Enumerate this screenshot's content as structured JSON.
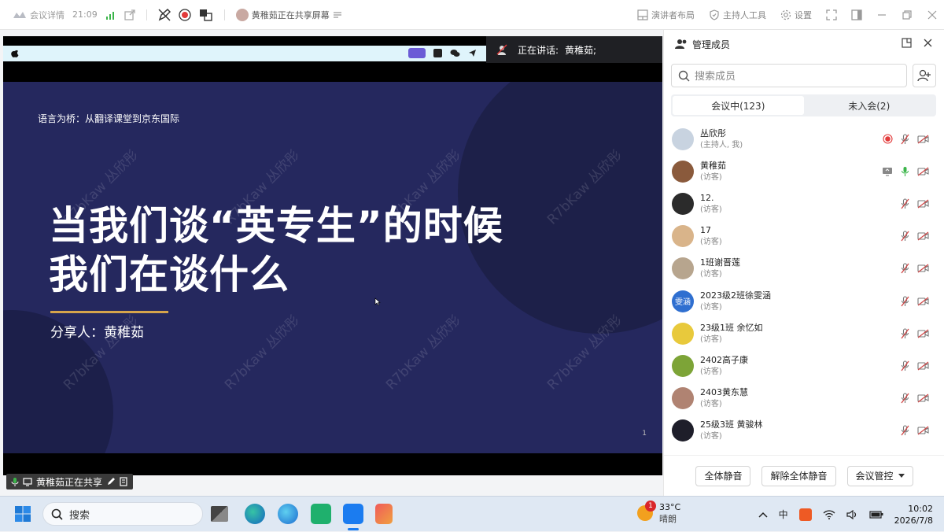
{
  "topbar": {
    "meeting_details": "会议详情",
    "time": "21:09",
    "sharing_label": "黄稚茹正在共享屏幕",
    "presenter_layout": "演讲者布局",
    "host_tools": "主持人工具",
    "settings": "设置"
  },
  "stage": {
    "speaking_prefix": "正在讲话:",
    "speaking_name": "黄稚茹;",
    "sharing_badge": "黄稚茹正在共享"
  },
  "slide": {
    "subtitle": "语言为桥：从翻译课堂到京东国际",
    "title_line1": "当我们谈“英专生”的时候",
    "title_line2": "我们在谈什么",
    "presenter": "分享人：黄稚茹",
    "page": "1",
    "watermark": "R7bKaw 丛欣彤"
  },
  "panel": {
    "title": "管理成员",
    "search_placeholder": "搜索成员",
    "tab_in_meeting": "会议中(123)",
    "tab_not_joined": "未入会(2)",
    "members": [
      {
        "name": "丛欣彤",
        "role": "(主持人, 我)",
        "avatar_color": "#c8d3e0",
        "avatar_text": "",
        "recording": true,
        "sharing": false,
        "mic": "muted"
      },
      {
        "name": "黄稚茹",
        "role": "(访客)",
        "avatar_color": "#8a5a3c",
        "avatar_text": "",
        "recording": false,
        "sharing": true,
        "mic": "on"
      },
      {
        "name": "12.",
        "role": "(访客)",
        "avatar_color": "#2b2b2b",
        "avatar_text": "",
        "recording": false,
        "sharing": false,
        "mic": "muted"
      },
      {
        "name": "17",
        "role": "(访客)",
        "avatar_color": "#d9b48a",
        "avatar_text": "",
        "recording": false,
        "sharing": false,
        "mic": "muted"
      },
      {
        "name": "1班谢晋莲",
        "role": "(访客)",
        "avatar_color": "#b7a58e",
        "avatar_text": "",
        "recording": false,
        "sharing": false,
        "mic": "muted"
      },
      {
        "name": "2023级2班徐雯涵",
        "role": "(访客)",
        "avatar_color": "#2f6fd0",
        "avatar_text": "雯涵",
        "recording": false,
        "sharing": false,
        "mic": "muted"
      },
      {
        "name": "23级1班 余忆如",
        "role": "(访客)",
        "avatar_color": "#e8c93c",
        "avatar_text": "",
        "recording": false,
        "sharing": false,
        "mic": "muted"
      },
      {
        "name": "2402高子康",
        "role": "(访客)",
        "avatar_color": "#7da437",
        "avatar_text": "",
        "recording": false,
        "sharing": false,
        "mic": "muted"
      },
      {
        "name": "2403黄东慧",
        "role": "(访客)",
        "avatar_color": "#b08372",
        "avatar_text": "",
        "recording": false,
        "sharing": false,
        "mic": "muted"
      },
      {
        "name": "25级3班 黄骏林",
        "role": "(访客)",
        "avatar_color": "#1e1e2a",
        "avatar_text": "",
        "recording": false,
        "sharing": false,
        "mic": "muted"
      }
    ],
    "btn_mute_all": "全体静音",
    "btn_unmute_all": "解除全体静音",
    "btn_meeting_control": "会议管控"
  },
  "taskbar": {
    "search_label": "搜索",
    "weather_badge": "1",
    "temperature": "33°C",
    "weather_text": "晴朗",
    "ime_label": "中",
    "time": "10:02",
    "date": "2026/7/8"
  },
  "colors": {
    "slide_bg": "#25285e",
    "accent_line": "#d6a44b",
    "recording_red": "#e23b3b",
    "mic_green": "#3bb54a",
    "muted_red": "#d04848"
  }
}
